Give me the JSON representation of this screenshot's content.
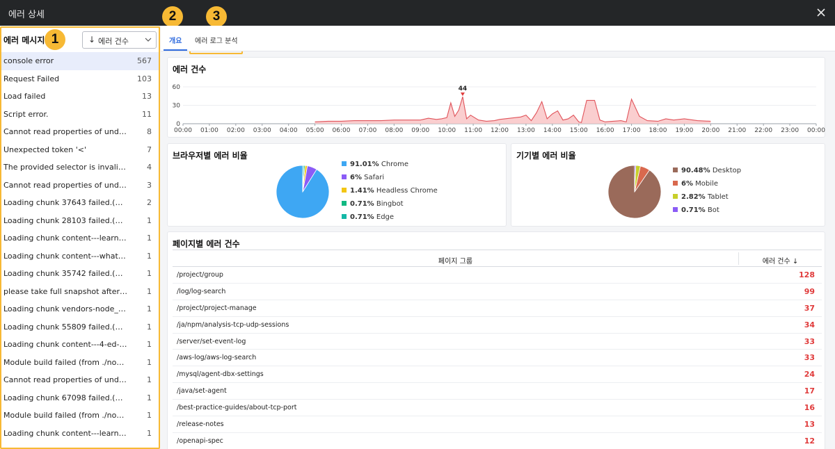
{
  "window": {
    "title": "에러 상세"
  },
  "left_panel": {
    "header": "에러 메시지",
    "sort_label": "에러 건수",
    "messages": [
      {
        "text": "console error",
        "count": "567"
      },
      {
        "text": "Request Failed",
        "count": "103"
      },
      {
        "text": "Load failed",
        "count": "13"
      },
      {
        "text": "Script error.",
        "count": "11"
      },
      {
        "text": "Cannot read properties of undefined (reading",
        "count": "8"
      },
      {
        "text": "Unexpected token '<'",
        "count": "7"
      },
      {
        "text": "The provided selector is invalid.Expected",
        "count": "4"
      },
      {
        "text": "Cannot read properties of undefined (reading",
        "count": "3"
      },
      {
        "text": "Loading chunk 37643 failed.(missing",
        "count": "2"
      },
      {
        "text": "Loading chunk 28103 failed.(missing",
        "count": "1"
      },
      {
        "text": "Loading chunk content---learning-guide",
        "count": "1"
      },
      {
        "text": "Loading chunk content---whatap-overview",
        "count": "1"
      },
      {
        "text": "Loading chunk 35742 failed.(error: http",
        "count": "1"
      },
      {
        "text": "please take full snapshot after start",
        "count": "1"
      },
      {
        "text": "Loading chunk vendors-node_modules",
        "count": "1"
      },
      {
        "text": "Loading chunk 55809 failed.(missing",
        "count": "1"
      },
      {
        "text": "Loading chunk content---4-ed-c51 failed",
        "count": "1"
      },
      {
        "text": "Module build failed (from ./node_modules",
        "count": "1"
      },
      {
        "text": "Cannot read properties of undefined (reading",
        "count": "1"
      },
      {
        "text": "Loading chunk 67098 failed.(error: http",
        "count": "1"
      },
      {
        "text": "Module build failed (from ./node_modules",
        "count": "1"
      },
      {
        "text": "Loading chunk content---learning-guide",
        "count": "1"
      }
    ]
  },
  "callouts": [
    "1",
    "2",
    "3"
  ],
  "tabs": [
    {
      "label": "개요",
      "active": true
    },
    {
      "label": "에러 로그 분석",
      "active": false
    }
  ],
  "error_count_chart": {
    "title": "에러 건수",
    "peak_label": "44",
    "chart_data": {
      "type": "area",
      "x_ticks": [
        "00:00",
        "01:00",
        "02:00",
        "03:00",
        "04:00",
        "05:00",
        "06:00",
        "07:00",
        "08:00",
        "09:00",
        "10:00",
        "11:00",
        "12:00",
        "13:00",
        "14:00",
        "15:00",
        "16:00",
        "17:00",
        "18:00",
        "19:00",
        "20:00",
        "21:00",
        "22:00",
        "23:00",
        "00:00"
      ],
      "y_ticks": [
        0,
        30,
        60
      ],
      "ylim": [
        0,
        60
      ],
      "xlim": [
        0,
        24
      ],
      "x": [
        5.0,
        5.5,
        6.0,
        6.5,
        7.0,
        7.5,
        8.0,
        8.5,
        9.0,
        9.3,
        9.6,
        9.8,
        10.0,
        10.15,
        10.3,
        10.45,
        10.6,
        10.75,
        10.9,
        11.2,
        11.5,
        11.8,
        12.0,
        12.4,
        12.8,
        13.0,
        13.2,
        13.4,
        13.6,
        13.8,
        14.0,
        14.2,
        14.4,
        14.6,
        14.8,
        15.0,
        15.1,
        15.3,
        15.5,
        15.6,
        15.8,
        16.0,
        16.3,
        16.6,
        16.8,
        17.0,
        17.3,
        17.6,
        18.0,
        18.3,
        18.6,
        19.0,
        19.5,
        20.0
      ],
      "y": [
        3,
        4,
        4,
        5,
        5,
        5,
        6,
        6,
        6,
        9,
        7,
        8,
        10,
        34,
        12,
        22,
        44,
        8,
        14,
        6,
        4,
        5,
        7,
        9,
        11,
        14,
        5,
        18,
        36,
        8,
        16,
        21,
        6,
        8,
        14,
        3,
        2,
        38,
        38,
        38,
        6,
        3,
        4,
        5,
        3,
        40,
        12,
        5,
        4,
        8,
        6,
        8,
        5,
        4
      ],
      "color": "#e0535a",
      "fill": "#f9c5c7"
    }
  },
  "browser_chart": {
    "title": "브라우저별 에러 비율",
    "chart_data": {
      "type": "pie",
      "slices": [
        {
          "pct": "91.01%",
          "label": "Chrome",
          "value": 91.01,
          "color": "#3ea7f3"
        },
        {
          "pct": "6%",
          "label": "Safari",
          "value": 6,
          "color": "#8b5cf6"
        },
        {
          "pct": "1.41%",
          "label": "Headless Chrome",
          "value": 1.41,
          "color": "#f3c614"
        },
        {
          "pct": "0.71%",
          "label": "Bingbot",
          "value": 0.71,
          "color": "#10b981"
        },
        {
          "pct": "0.71%",
          "label": "Edge",
          "value": 0.71,
          "color": "#14b8a6"
        }
      ]
    }
  },
  "device_chart": {
    "title": "기기별 에러 비율",
    "chart_data": {
      "type": "pie",
      "slices": [
        {
          "pct": "90.48%",
          "label": "Desktop",
          "value": 90.48,
          "color": "#9a6a5a"
        },
        {
          "pct": "6%",
          "label": "Mobile",
          "value": 6,
          "color": "#d9694e"
        },
        {
          "pct": "2.82%",
          "label": "Tablet",
          "value": 2.82,
          "color": "#c8cf2a"
        },
        {
          "pct": "0.71%",
          "label": "Bot",
          "value": 0.71,
          "color": "#8b5cf6"
        }
      ]
    }
  },
  "page_table": {
    "title": "페이지별 에러 건수",
    "col_page": "페이지 그룹",
    "col_count": "에러 건수",
    "rows": [
      {
        "page": "/project/group",
        "count": "128"
      },
      {
        "page": "/log/log-search",
        "count": "99"
      },
      {
        "page": "/project/project-manage",
        "count": "37"
      },
      {
        "page": "/ja/npm/analysis-tcp-udp-sessions",
        "count": "34"
      },
      {
        "page": "/server/set-event-log",
        "count": "33"
      },
      {
        "page": "/aws-log/aws-log-search",
        "count": "33"
      },
      {
        "page": "/mysql/agent-dbx-settings",
        "count": "24"
      },
      {
        "page": "/java/set-agent",
        "count": "17"
      },
      {
        "page": "/best-practice-guides/about-tcp-port",
        "count": "16"
      },
      {
        "page": "/release-notes",
        "count": "13"
      },
      {
        "page": "/openapi-spec",
        "count": "12"
      }
    ]
  }
}
